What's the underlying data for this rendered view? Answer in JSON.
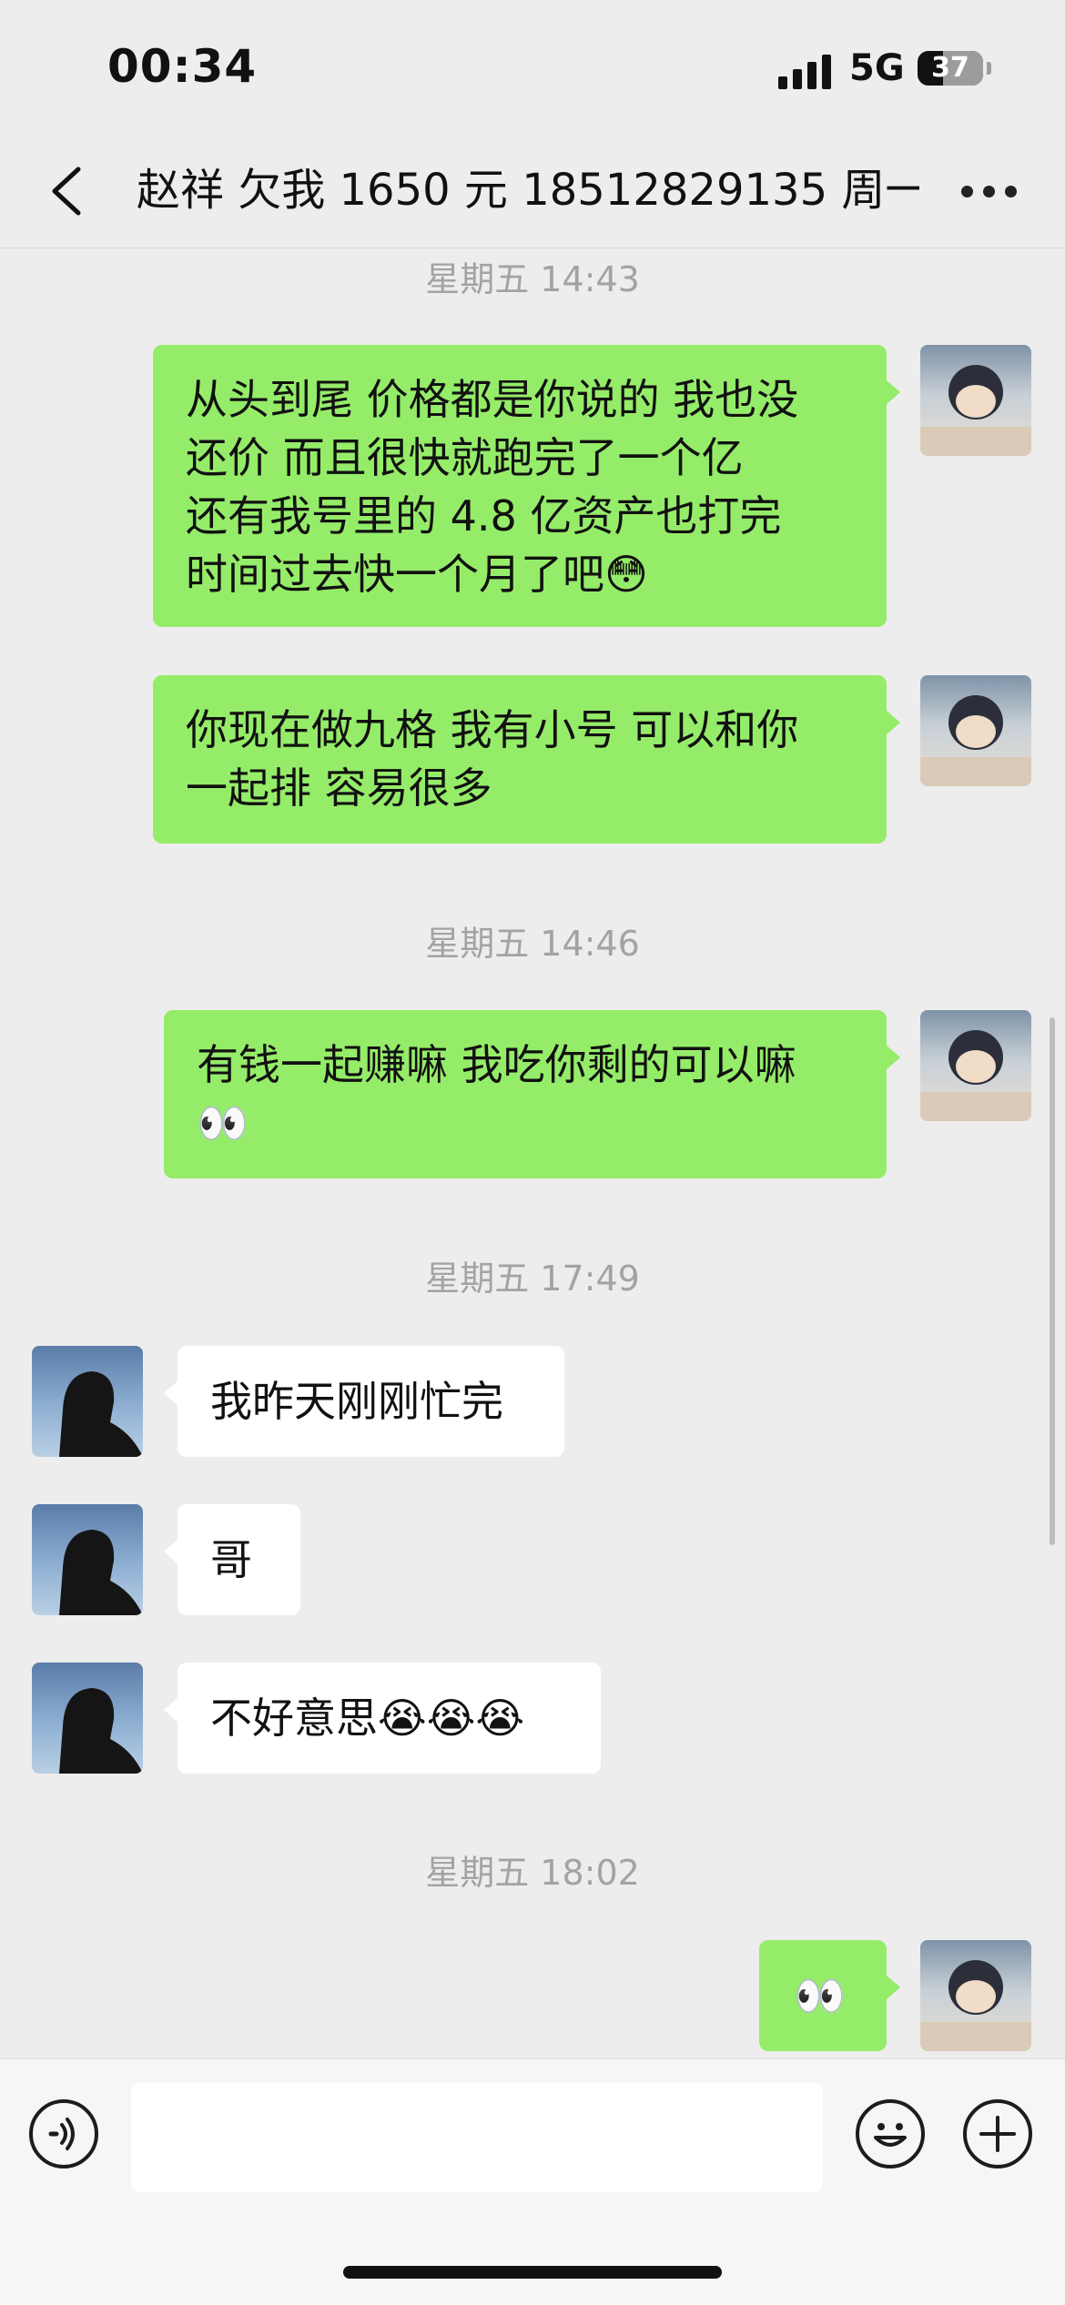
{
  "status_bar": {
    "time": "00:34",
    "network": "5G",
    "battery": "37",
    "battery_percent": 37
  },
  "header": {
    "title": "赵祥 欠我 1650 元 18512829135 周一",
    "back_icon": "chevron-left-icon",
    "more_icon": "more-dots-icon"
  },
  "messages": [
    {
      "type": "timestamp",
      "text": "星期五 14:43"
    },
    {
      "type": "outgoing",
      "text": "从头到尾 价格都是你说的 我也没\n还价  而且很快就跑完了一个亿\n还有我号里的 4.8 亿资产也打完\n时间过去快一个月了吧😳"
    },
    {
      "type": "outgoing",
      "text": "你现在做九格 我有小号 可以和你\n一起排 容易很多"
    },
    {
      "type": "timestamp",
      "text": "星期五 14:46"
    },
    {
      "type": "outgoing",
      "text": "有钱一起赚嘛 我吃你剩的可以嘛\n👀"
    },
    {
      "type": "timestamp",
      "text": "星期五 17:49"
    },
    {
      "type": "incoming",
      "text": "我昨天刚刚忙完"
    },
    {
      "type": "incoming",
      "text": "哥"
    },
    {
      "type": "incoming",
      "text": "不好意思😭😭😭"
    },
    {
      "type": "timestamp",
      "text": "星期五 18:02"
    },
    {
      "type": "outgoing",
      "text": "👀"
    }
  ],
  "input_bar": {
    "voice_icon": "voice-icon",
    "emoji_icon": "emoji-icon",
    "plus_icon": "plus-icon",
    "input_value": ""
  },
  "colors": {
    "background": "#ededed",
    "outgoing_bubble": "#95ec69",
    "incoming_bubble": "#ffffff",
    "timestamp": "#a3a3a3"
  }
}
